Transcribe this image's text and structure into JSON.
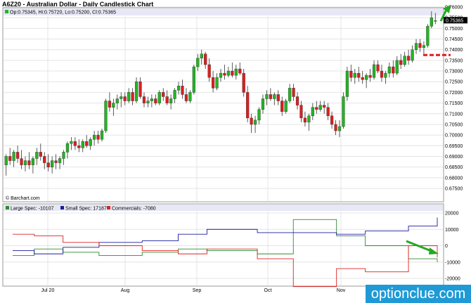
{
  "title": "A6Z20 - Australian Dollar - Daily Candlestick Chart",
  "ohlc_label": "Op:0.75345, Hi:0.75720, Lo:0.75200, Cl:0.75365",
  "last_price": "0.75365",
  "source": "© Barchart.com",
  "watermark": "optionclue.com",
  "colors": {
    "up": "#22b522",
    "down": "#dd1e1e",
    "large_spec": "#2e8b2e",
    "small_spec": "#1c1c9e",
    "commercials": "#e02020",
    "annotation": "#22aa22",
    "level": "#dd1e1e"
  },
  "chart_data": [
    {
      "type": "candlestick",
      "ylim": [
        0.675,
        0.76
      ],
      "y_ticks": [
        "0.76000",
        "0.75500",
        "0.75000",
        "0.74500",
        "0.74000",
        "0.73500",
        "0.73000",
        "0.72500",
        "0.72000",
        "0.71500",
        "0.71000",
        "0.70500",
        "0.70000",
        "0.69500",
        "0.69000",
        "0.68500",
        "0.68000",
        "0.67500"
      ],
      "x_ticks": [
        "Jul 20",
        "Aug",
        "Sep",
        "Oct",
        "Nov"
      ],
      "ohlc": [
        [
          0.686,
          0.691,
          0.681,
          0.69
        ],
        [
          0.69,
          0.694,
          0.686,
          0.688
        ],
        [
          0.688,
          0.693,
          0.685,
          0.692
        ],
        [
          0.692,
          0.695,
          0.687,
          0.689
        ],
        [
          0.689,
          0.693,
          0.684,
          0.686
        ],
        [
          0.686,
          0.69,
          0.683,
          0.688
        ],
        [
          0.688,
          0.692,
          0.684,
          0.686
        ],
        [
          0.686,
          0.69,
          0.682,
          0.689
        ],
        [
          0.689,
          0.694,
          0.686,
          0.692
        ],
        [
          0.692,
          0.696,
          0.688,
          0.69
        ],
        [
          0.69,
          0.692,
          0.684,
          0.687
        ],
        [
          0.687,
          0.691,
          0.683,
          0.685
        ],
        [
          0.685,
          0.69,
          0.682,
          0.688
        ],
        [
          0.688,
          0.691,
          0.684,
          0.687
        ],
        [
          0.687,
          0.69,
          0.684,
          0.689
        ],
        [
          0.689,
          0.693,
          0.686,
          0.692
        ],
        [
          0.692,
          0.697,
          0.689,
          0.696
        ],
        [
          0.696,
          0.699,
          0.693,
          0.697
        ],
        [
          0.697,
          0.699,
          0.693,
          0.695
        ],
        [
          0.695,
          0.698,
          0.692,
          0.694
        ],
        [
          0.694,
          0.698,
          0.692,
          0.697
        ],
        [
          0.697,
          0.7,
          0.694,
          0.695
        ],
        [
          0.695,
          0.699,
          0.693,
          0.698
        ],
        [
          0.698,
          0.702,
          0.695,
          0.7
        ],
        [
          0.7,
          0.702,
          0.696,
          0.698
        ],
        [
          0.698,
          0.703,
          0.697,
          0.702
        ],
        [
          0.702,
          0.717,
          0.701,
          0.716
        ],
        [
          0.716,
          0.72,
          0.711,
          0.713
        ],
        [
          0.713,
          0.717,
          0.709,
          0.715
        ],
        [
          0.715,
          0.719,
          0.712,
          0.717
        ],
        [
          0.717,
          0.72,
          0.713,
          0.718
        ],
        [
          0.718,
          0.72,
          0.714,
          0.716
        ],
        [
          0.716,
          0.722,
          0.715,
          0.72
        ],
        [
          0.72,
          0.722,
          0.714,
          0.716
        ],
        [
          0.716,
          0.727,
          0.715,
          0.725
        ],
        [
          0.725,
          0.727,
          0.717,
          0.718
        ],
        [
          0.718,
          0.72,
          0.713,
          0.715
        ],
        [
          0.715,
          0.718,
          0.713,
          0.716
        ],
        [
          0.716,
          0.719,
          0.713,
          0.717
        ],
        [
          0.717,
          0.719,
          0.714,
          0.715
        ],
        [
          0.715,
          0.721,
          0.714,
          0.72
        ],
        [
          0.72,
          0.722,
          0.716,
          0.718
        ],
        [
          0.718,
          0.721,
          0.714,
          0.715
        ],
        [
          0.715,
          0.719,
          0.712,
          0.717
        ],
        [
          0.717,
          0.722,
          0.715,
          0.721
        ],
        [
          0.721,
          0.725,
          0.719,
          0.723
        ],
        [
          0.723,
          0.726,
          0.717,
          0.719
        ],
        [
          0.719,
          0.722,
          0.715,
          0.716
        ],
        [
          0.716,
          0.721,
          0.715,
          0.72
        ],
        [
          0.72,
          0.733,
          0.719,
          0.732
        ],
        [
          0.732,
          0.738,
          0.73,
          0.736
        ],
        [
          0.736,
          0.74,
          0.733,
          0.738
        ],
        [
          0.738,
          0.739,
          0.731,
          0.733
        ],
        [
          0.733,
          0.736,
          0.725,
          0.727
        ],
        [
          0.727,
          0.73,
          0.72,
          0.722
        ],
        [
          0.722,
          0.729,
          0.721,
          0.727
        ],
        [
          0.727,
          0.731,
          0.725,
          0.729
        ],
        [
          0.729,
          0.733,
          0.726,
          0.728
        ],
        [
          0.728,
          0.732,
          0.727,
          0.73
        ],
        [
          0.73,
          0.734,
          0.727,
          0.728
        ],
        [
          0.728,
          0.733,
          0.726,
          0.731
        ],
        [
          0.731,
          0.734,
          0.728,
          0.729
        ],
        [
          0.729,
          0.731,
          0.718,
          0.72
        ],
        [
          0.72,
          0.723,
          0.706,
          0.708
        ],
        [
          0.708,
          0.71,
          0.701,
          0.705
        ],
        [
          0.705,
          0.709,
          0.701,
          0.707
        ],
        [
          0.707,
          0.713,
          0.705,
          0.712
        ],
        [
          0.712,
          0.719,
          0.71,
          0.717
        ],
        [
          0.717,
          0.721,
          0.714,
          0.719
        ],
        [
          0.719,
          0.722,
          0.716,
          0.717
        ],
        [
          0.717,
          0.72,
          0.714,
          0.719
        ],
        [
          0.719,
          0.721,
          0.714,
          0.716
        ],
        [
          0.716,
          0.718,
          0.709,
          0.711
        ],
        [
          0.711,
          0.717,
          0.71,
          0.716
        ],
        [
          0.716,
          0.724,
          0.715,
          0.722
        ],
        [
          0.722,
          0.724,
          0.716,
          0.718
        ],
        [
          0.718,
          0.72,
          0.712,
          0.714
        ],
        [
          0.714,
          0.716,
          0.706,
          0.708
        ],
        [
          0.708,
          0.711,
          0.704,
          0.706
        ],
        [
          0.706,
          0.71,
          0.702,
          0.709
        ],
        [
          0.709,
          0.715,
          0.707,
          0.713
        ],
        [
          0.713,
          0.716,
          0.71,
          0.712
        ],
        [
          0.712,
          0.716,
          0.711,
          0.714
        ],
        [
          0.714,
          0.716,
          0.71,
          0.713
        ],
        [
          0.713,
          0.715,
          0.707,
          0.709
        ],
        [
          0.709,
          0.711,
          0.703,
          0.705
        ],
        [
          0.705,
          0.707,
          0.7,
          0.702
        ],
        [
          0.702,
          0.707,
          0.699,
          0.704
        ],
        [
          0.704,
          0.72,
          0.703,
          0.718
        ],
        [
          0.718,
          0.732,
          0.716,
          0.73
        ],
        [
          0.73,
          0.733,
          0.725,
          0.727
        ],
        [
          0.727,
          0.731,
          0.724,
          0.729
        ],
        [
          0.729,
          0.732,
          0.725,
          0.727
        ],
        [
          0.727,
          0.73,
          0.724,
          0.726
        ],
        [
          0.726,
          0.729,
          0.722,
          0.728
        ],
        [
          0.728,
          0.731,
          0.725,
          0.727
        ],
        [
          0.727,
          0.735,
          0.726,
          0.733
        ],
        [
          0.733,
          0.735,
          0.729,
          0.73
        ],
        [
          0.73,
          0.733,
          0.725,
          0.727
        ],
        [
          0.727,
          0.73,
          0.724,
          0.729
        ],
        [
          0.729,
          0.734,
          0.727,
          0.732
        ],
        [
          0.732,
          0.735,
          0.727,
          0.729
        ],
        [
          0.729,
          0.737,
          0.728,
          0.735
        ],
        [
          0.735,
          0.738,
          0.731,
          0.733
        ],
        [
          0.733,
          0.739,
          0.732,
          0.737
        ],
        [
          0.737,
          0.74,
          0.733,
          0.735
        ],
        [
          0.735,
          0.742,
          0.734,
          0.74
        ],
        [
          0.74,
          0.745,
          0.738,
          0.743
        ],
        [
          0.743,
          0.745,
          0.739,
          0.741
        ],
        [
          0.741,
          0.744,
          0.738,
          0.742
        ],
        [
          0.742,
          0.752,
          0.741,
          0.751
        ],
        [
          0.751,
          0.758,
          0.75,
          0.755
        ],
        [
          0.75345,
          0.7572,
          0.752,
          0.75365
        ]
      ],
      "annotations": {
        "level": 0.7375,
        "arrow": "up"
      }
    },
    {
      "type": "line",
      "ylim": [
        -20000,
        20000
      ],
      "y_ticks": [
        "20000",
        "10000",
        "0",
        "-10000",
        "-20000"
      ],
      "series": [
        {
          "name": "Large Spec: -10107",
          "values": [
            -6000,
            -6000,
            -6000,
            -2000,
            -2000,
            -2000,
            -2000,
            -4000,
            -4000,
            -4000,
            -4000,
            -4000,
            -6000,
            -6000,
            -6000,
            -6000,
            -6000,
            -6000,
            -4000,
            -4000,
            -4000,
            -4000,
            -4000,
            -2000,
            -2000,
            -2000,
            -2000,
            -3000,
            -3000,
            -3000,
            -3000,
            -3000,
            -3000,
            -3000,
            -5000,
            -5000,
            -5000,
            -5000,
            -5000,
            16000,
            16000,
            16000,
            16000,
            16000,
            16000,
            6000,
            6000,
            6000,
            6000,
            0,
            0,
            0,
            0,
            0,
            0,
            -8000,
            -8000,
            -8000,
            -8000,
            -10107
          ]
        },
        {
          "name": "Small Spec: 17187",
          "values": [
            -3000,
            -3000,
            -3000,
            -5000,
            -5000,
            -5000,
            -5000,
            -1000,
            -1000,
            -1000,
            -1000,
            -1000,
            2000,
            2000,
            2000,
            2000,
            2000,
            2000,
            3000,
            3000,
            3000,
            3000,
            3000,
            7000,
            7000,
            7000,
            7000,
            10000,
            10000,
            10000,
            10000,
            10000,
            10000,
            10000,
            8000,
            8000,
            8000,
            8000,
            8000,
            8000,
            8000,
            8000,
            8000,
            8000,
            8000,
            7000,
            7000,
            7000,
            7000,
            9000,
            9000,
            9000,
            9000,
            9000,
            9000,
            12000,
            12000,
            12000,
            12000,
            17187
          ]
        },
        {
          "name": "Commercials: -7080",
          "values": [
            7000,
            7000,
            7000,
            6000,
            6000,
            6000,
            6000,
            2000,
            2000,
            2000,
            2000,
            2000,
            0,
            0,
            0,
            0,
            0,
            0,
            -3000,
            -3000,
            -3000,
            -3000,
            -3000,
            -5000,
            -5000,
            -5000,
            -5000,
            -2000,
            -2000,
            -2000,
            -2000,
            -2000,
            -2000,
            -2000,
            -8000,
            -8000,
            -8000,
            -8000,
            -8000,
            -25000,
            -25000,
            -25000,
            -25000,
            -25000,
            -25000,
            -14000,
            -14000,
            -14000,
            -14000,
            -16000,
            -16000,
            -16000,
            -16000,
            -16000,
            -16000,
            0,
            0,
            0,
            0,
            -7080
          ]
        }
      ],
      "annotations": {
        "arrow": "down"
      }
    }
  ]
}
